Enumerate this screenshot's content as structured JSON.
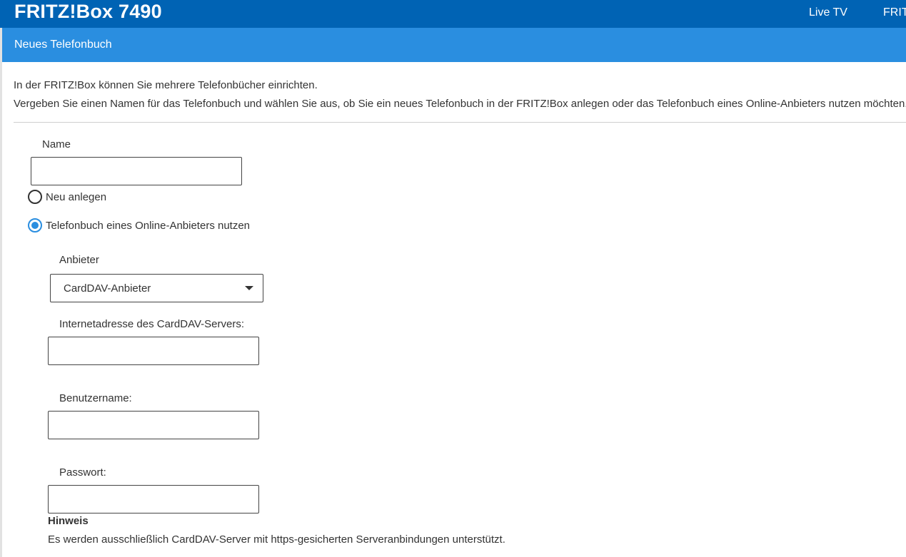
{
  "header": {
    "brand": "FRITZ!Box 7490",
    "nav": [
      "Live TV",
      "FRITZ!"
    ]
  },
  "page": {
    "title": "Neues Telefonbuch",
    "intro_line1": "In der FRITZ!Box können Sie mehrere Telefonbücher einrichten.",
    "intro_line2": "Vergeben Sie einen Namen für das Telefonbuch und wählen Sie aus, ob Sie ein neues Telefonbuch in der FRITZ!Box anlegen oder das Telefonbuch eines Online-Anbieters nutzen möchten."
  },
  "form": {
    "name_label": "Name",
    "name_value": "",
    "radio_new": {
      "label": "Neu anlegen",
      "checked": false
    },
    "radio_online": {
      "label": "Telefonbuch eines Online-Anbieters nutzen",
      "checked": true
    },
    "provider_label": "Anbieter",
    "provider_value": "CardDAV-Anbieter",
    "server_label": "Internetadresse des CardDAV-Servers:",
    "server_value": "",
    "username_label": "Benutzername:",
    "username_value": "",
    "password_label": "Passwort:",
    "password_value": ""
  },
  "hint": {
    "title": "Hinweis",
    "text": "Es werden ausschließlich CardDAV-Server mit https-gesicherten Serveranbindungen unterstützt."
  },
  "colors": {
    "topbar": "#0063b4",
    "titlebar": "#2a8ee0",
    "radio_accent": "#2a8ee0"
  }
}
